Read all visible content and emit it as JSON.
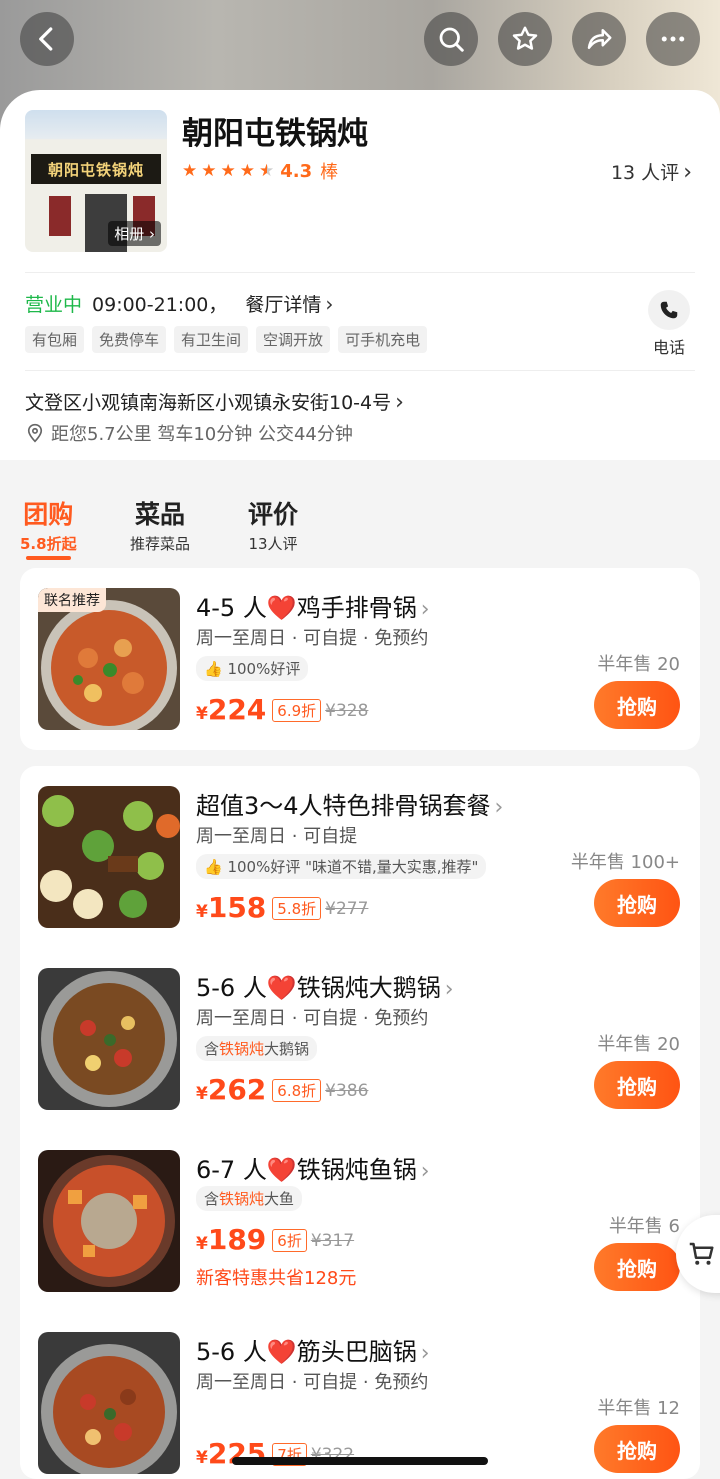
{
  "store": {
    "name": "朝阳屯铁锅炖",
    "photo_sign": "朝阳屯铁锅炖",
    "photo_badge": "相册",
    "rating_score": "4.3",
    "rating_word": "棒",
    "review_count": "13 人评",
    "status": "营业中",
    "hours": "09:00-21:00，",
    "detail_link": "餐厅详情",
    "tags": [
      "有包厢",
      "免费停车",
      "有卫生间",
      "空调开放",
      "可手机充电"
    ],
    "phone_label": "电话",
    "address": "文登区小观镇南海新区小观镇永安街10-4号",
    "distance": "距您5.7公里  驾车10分钟  公交44分钟"
  },
  "tabs": [
    {
      "title": "团购",
      "sub": "5.8折起"
    },
    {
      "title": "菜品",
      "sub": "推荐菜品"
    },
    {
      "title": "评价",
      "sub": "13人评"
    }
  ],
  "deals": [
    {
      "badge": "联名推荐",
      "title_pre": "4-5 人",
      "title_post": "鸡手排骨锅",
      "meta": "周一至周日 · 可自提 · 免预约",
      "chip": "100%好评",
      "price": "224",
      "discount": "6.9折",
      "orig_price": "¥328",
      "sold": "半年售 20",
      "buy": "抢购"
    },
    {
      "title_pre": "超值3～4人特色排骨锅套餐",
      "title_post": "",
      "meta": "周一至周日 · 可自提",
      "chip": "100%好评 \"味道不错,量大实惠,推荐\"",
      "price": "158",
      "discount": "5.8折",
      "orig_price": "¥277",
      "sold": "半年售 100+",
      "buy": "抢购"
    },
    {
      "title_pre": "5-6 人",
      "title_post": "铁锅炖大鹅锅",
      "meta": "周一至周日 · 可自提 · 免预约",
      "chip_pre": "含",
      "chip_hl": "铁锅炖",
      "chip_post": "大鹅锅",
      "price": "262",
      "discount": "6.8折",
      "orig_price": "¥386",
      "sold": "半年售 20",
      "buy": "抢购"
    },
    {
      "title_pre": "6-7 人",
      "title_post": "铁锅炖鱼锅",
      "chip_pre": "含",
      "chip_hl": "铁锅炖",
      "chip_post": "大鱼",
      "price": "189",
      "discount": "6折",
      "orig_price": "¥317",
      "promo": "新客特惠共省128元",
      "sold": "半年售 6",
      "buy": "抢购"
    },
    {
      "title_pre": "5-6 人",
      "title_post": "筋头巴脑锅",
      "meta": "周一至周日 · 可自提 · 免预约",
      "price": "225",
      "discount": "7折",
      "orig_price": "¥322",
      "sold": "半年售 12",
      "buy": "抢购"
    }
  ],
  "currency": "¥",
  "heart": "❤️"
}
